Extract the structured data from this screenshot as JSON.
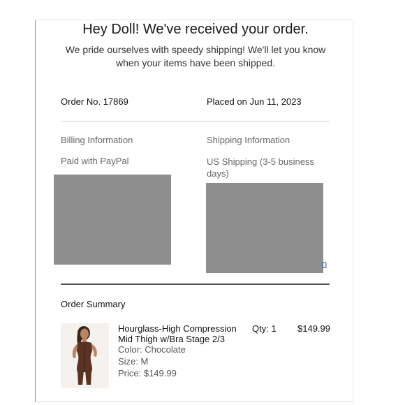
{
  "email": {
    "heading": "Hey Doll! We've received your order.",
    "intro": "We pride ourselves with speedy shipping! We'll let you know when your items have been shipped."
  },
  "order": {
    "number_label": "Order No.",
    "number": "17869",
    "placed_label": "Placed on",
    "placed_date": "Jun 11, 2023"
  },
  "billing": {
    "label": "Billing Information",
    "payment": "Paid with PayPal"
  },
  "shipping": {
    "label": "Shipping Information",
    "method": "US Shipping (3-5 business days)",
    "link_fragment": "n"
  },
  "summary": {
    "title": "Order Summary",
    "items": [
      {
        "name": "Hourglass-High Compression Mid Thigh w/Bra Stage 2/3",
        "color": "Color: Chocolate",
        "size": "Size: M",
        "price": "Price: $149.99",
        "qty": "Qty: 1",
        "total": "$149.99",
        "image_icon": "product-photo"
      }
    ]
  },
  "colors": {
    "redaction": "#8e8e8e",
    "garment": "#5a3322",
    "link": "#2a62c8"
  }
}
